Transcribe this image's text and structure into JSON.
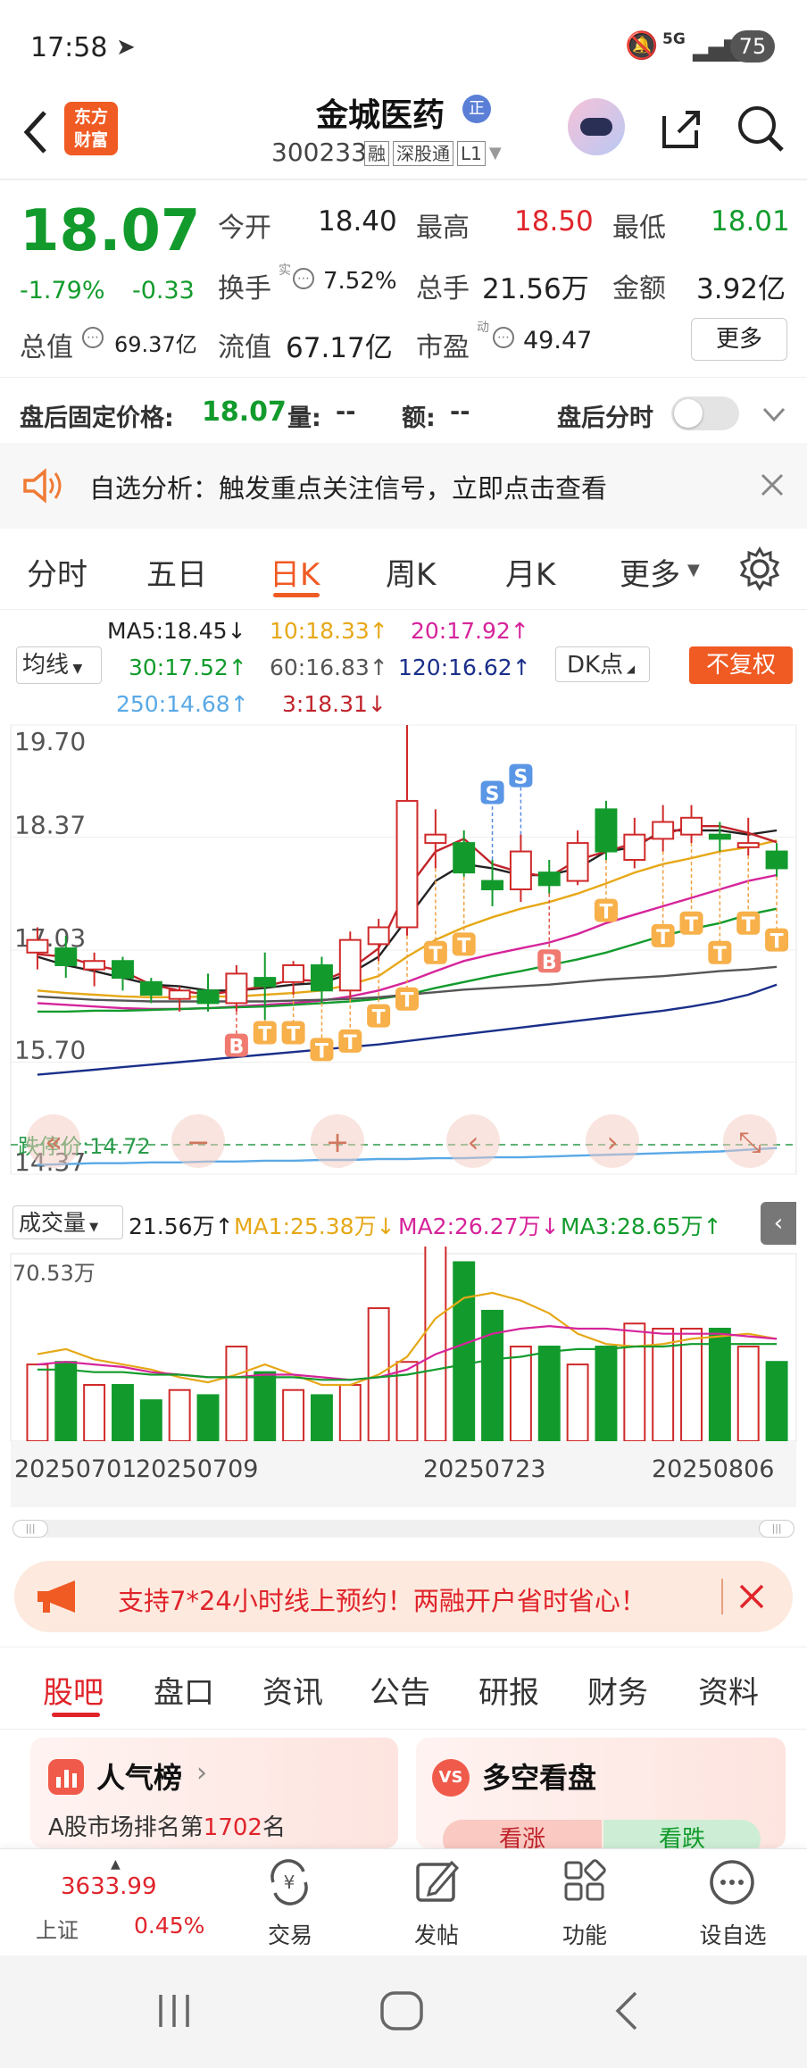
{
  "status_bar": {
    "time": "17:58",
    "battery": "75",
    "signal_label": "5G"
  },
  "header": {
    "title": "金城医药",
    "code": "300233",
    "badges": [
      "融",
      "深股通",
      "L1"
    ],
    "logo_line1": "东方",
    "logo_line2": "财富",
    "title_badge": "正"
  },
  "quote": {
    "price": "18.07",
    "change_pct": "-1.79%",
    "change": "-0.33",
    "stats": [
      {
        "label": "今开",
        "value": "18.40"
      },
      {
        "label": "最高",
        "value": "18.50"
      },
      {
        "label": "最低",
        "value": "18.01"
      },
      {
        "label": "换手",
        "value": "7.52%"
      },
      {
        "label": "总手",
        "value": "21.56万"
      },
      {
        "label": "金额",
        "value": "3.92亿"
      },
      {
        "label": "总值",
        "value": "69.37亿"
      },
      {
        "label": "流值",
        "value": "67.17亿"
      },
      {
        "label": "市盈",
        "value": "49.47"
      }
    ],
    "turnover_sup": "实",
    "pe_sup": "动",
    "more_button": "更多"
  },
  "after_hours": {
    "price_label": "盘后固定价格:",
    "price": "18.07",
    "volume_label": "量:",
    "volume": "--",
    "amount_label": "额:",
    "amount": "--",
    "timeshare_label": "盘后分时"
  },
  "notice": {
    "text": "自选分析：触发重点关注信号，立即点击查看"
  },
  "chart_tabs": [
    "分时",
    "五日",
    "日K",
    "周K",
    "月K",
    "更多"
  ],
  "ma_legend": {
    "selector": "均线",
    "items": [
      {
        "text": "MA5:18.45↓",
        "color": "#222222"
      },
      {
        "text": "10:18.33↑",
        "color": "#e6a817"
      },
      {
        "text": "20:17.92↑",
        "color": "#d6249b"
      },
      {
        "text": "30:17.52↑",
        "color": "#129b2c"
      },
      {
        "text": "60:16.83↑",
        "color": "#555555"
      },
      {
        "text": "120:16.62↑",
        "color": "#1a2f8a"
      },
      {
        "text": "250:14.68↑",
        "color": "#5aa9e6"
      },
      {
        "text": "3:18.31↓",
        "color": "#c0242b"
      }
    ],
    "dk_button": "DK点",
    "fq_button": "不复权"
  },
  "chart_data": {
    "type": "candlestick",
    "y_ticks": [
      "19.70",
      "18.37",
      "17.03",
      "15.70",
      "14.37"
    ],
    "ylim": [
      14.37,
      19.7
    ],
    "limit_down_label": "跌停价:14.72",
    "limit_down": 14.72,
    "candles": [
      {
        "o": 17.0,
        "c": 17.15,
        "h": 17.3,
        "l": 16.8
      },
      {
        "o": 17.05,
        "c": 16.85,
        "h": 17.2,
        "l": 16.7
      },
      {
        "o": 16.8,
        "c": 16.9,
        "h": 17.0,
        "l": 16.6
      },
      {
        "o": 16.9,
        "c": 16.7,
        "h": 16.95,
        "l": 16.55
      },
      {
        "o": 16.65,
        "c": 16.5,
        "h": 16.7,
        "l": 16.4
      },
      {
        "o": 16.45,
        "c": 16.55,
        "h": 16.6,
        "l": 16.3
      },
      {
        "o": 16.55,
        "c": 16.4,
        "h": 16.75,
        "l": 16.3
      },
      {
        "o": 16.4,
        "c": 16.75,
        "h": 16.85,
        "l": 16.3
      },
      {
        "o": 16.7,
        "c": 16.6,
        "h": 17.0,
        "l": 16.2
      },
      {
        "o": 16.65,
        "c": 16.85,
        "h": 16.9,
        "l": 16.5
      },
      {
        "o": 16.85,
        "c": 16.55,
        "h": 16.95,
        "l": 16.4
      },
      {
        "o": 16.55,
        "c": 17.15,
        "h": 17.25,
        "l": 16.45
      },
      {
        "o": 17.1,
        "c": 17.3,
        "h": 17.4,
        "l": 16.9
      },
      {
        "o": 17.3,
        "c": 18.8,
        "h": 19.7,
        "l": 17.2
      },
      {
        "o": 18.3,
        "c": 18.4,
        "h": 18.7,
        "l": 18.0
      },
      {
        "o": 18.3,
        "c": 17.95,
        "h": 18.45,
        "l": 17.9
      },
      {
        "o": 17.85,
        "c": 17.75,
        "h": 18.1,
        "l": 17.55
      },
      {
        "o": 17.75,
        "c": 18.2,
        "h": 18.4,
        "l": 17.6
      },
      {
        "o": 17.95,
        "c": 17.8,
        "h": 18.1,
        "l": 17.7
      },
      {
        "o": 17.85,
        "c": 18.3,
        "h": 18.45,
        "l": 17.8
      },
      {
        "o": 18.7,
        "c": 18.2,
        "h": 18.8,
        "l": 18.1
      },
      {
        "o": 18.1,
        "c": 18.4,
        "h": 18.6,
        "l": 18.0
      },
      {
        "o": 18.35,
        "c": 18.55,
        "h": 18.75,
        "l": 18.2
      },
      {
        "o": 18.4,
        "c": 18.6,
        "h": 18.75,
        "l": 18.3
      },
      {
        "o": 18.4,
        "c": 18.35,
        "h": 18.55,
        "l": 18.2
      },
      {
        "o": 18.25,
        "c": 18.3,
        "h": 18.6,
        "l": 18.15
      },
      {
        "o": 18.2,
        "c": 18.0,
        "h": 18.3,
        "l": 17.9
      }
    ],
    "markers": [
      {
        "i": 7,
        "t": "B",
        "y": 15.9
      },
      {
        "i": 8,
        "t": "T",
        "y": 16.05
      },
      {
        "i": 9,
        "t": "T",
        "y": 16.05
      },
      {
        "i": 10,
        "t": "T",
        "y": 15.85
      },
      {
        "i": 11,
        "t": "T",
        "y": 15.95
      },
      {
        "i": 12,
        "t": "T",
        "y": 16.25
      },
      {
        "i": 13,
        "t": "T",
        "y": 16.45
      },
      {
        "i": 14,
        "t": "T",
        "y": 17.0
      },
      {
        "i": 15,
        "t": "T",
        "y": 17.1
      },
      {
        "i": 18,
        "t": "B",
        "y": 16.9
      },
      {
        "i": 20,
        "t": "T",
        "y": 17.5
      },
      {
        "i": 22,
        "t": "T",
        "y": 17.2
      },
      {
        "i": 23,
        "t": "T",
        "y": 17.35
      },
      {
        "i": 24,
        "t": "T",
        "y": 17.0
      },
      {
        "i": 25,
        "t": "T",
        "y": 17.35
      },
      {
        "i": 26,
        "t": "T",
        "y": 17.15
      },
      {
        "i": 16,
        "t": "S",
        "y": 18.9
      },
      {
        "i": 17,
        "t": "S",
        "y": 19.1
      }
    ],
    "ma_lines": [
      {
        "name": "MA5",
        "color": "#222222",
        "values": [
          16.95,
          16.85,
          16.78,
          16.7,
          16.62,
          16.6,
          16.55,
          16.55,
          16.58,
          16.62,
          16.64,
          16.75,
          16.95,
          17.4,
          17.85,
          18.05,
          18.0,
          17.92,
          17.92,
          18.0,
          18.2,
          18.25,
          18.45,
          18.45,
          18.45,
          18.4,
          18.45
        ]
      },
      {
        "name": "MA10",
        "color": "#e6a817",
        "values": [
          16.55,
          16.52,
          16.5,
          16.48,
          16.47,
          16.47,
          16.48,
          16.48,
          16.5,
          16.52,
          16.55,
          16.62,
          16.72,
          16.95,
          17.15,
          17.3,
          17.42,
          17.52,
          17.6,
          17.7,
          17.82,
          17.95,
          18.05,
          18.12,
          18.2,
          18.25,
          18.33
        ]
      },
      {
        "name": "MA20",
        "color": "#d6249b",
        "values": [
          16.4,
          16.38,
          16.36,
          16.34,
          16.33,
          16.33,
          16.34,
          16.36,
          16.38,
          16.4,
          16.43,
          16.48,
          16.55,
          16.65,
          16.78,
          16.9,
          16.98,
          17.05,
          17.12,
          17.22,
          17.35,
          17.45,
          17.55,
          17.65,
          17.75,
          17.85,
          17.92
        ]
      },
      {
        "name": "MA30",
        "color": "#129b2c",
        "values": [
          16.3,
          16.3,
          16.31,
          16.31,
          16.32,
          16.33,
          16.34,
          16.35,
          16.36,
          16.38,
          16.4,
          16.42,
          16.45,
          16.5,
          16.58,
          16.65,
          16.72,
          16.78,
          16.85,
          16.92,
          17.0,
          17.1,
          17.2,
          17.28,
          17.35,
          17.45,
          17.52
        ]
      },
      {
        "name": "MA60",
        "color": "#555555",
        "values": [
          16.48,
          16.46,
          16.44,
          16.43,
          16.42,
          16.42,
          16.42,
          16.42,
          16.42,
          16.43,
          16.44,
          16.45,
          16.47,
          16.5,
          16.53,
          16.56,
          16.58,
          16.6,
          16.62,
          16.65,
          16.68,
          16.7,
          16.72,
          16.75,
          16.78,
          16.8,
          16.83
        ]
      },
      {
        "name": "MA120",
        "color": "#1a2f8a",
        "values": [
          15.55,
          15.58,
          15.61,
          15.64,
          15.67,
          15.7,
          15.73,
          15.76,
          15.79,
          15.82,
          15.85,
          15.88,
          15.91,
          15.95,
          15.99,
          16.03,
          16.07,
          16.11,
          16.15,
          16.19,
          16.23,
          16.27,
          16.31,
          16.36,
          16.42,
          16.5,
          16.62
        ]
      },
      {
        "name": "MA250",
        "color": "#5aa9e6",
        "values": [
          14.48,
          14.49,
          14.5,
          14.5,
          14.51,
          14.51,
          14.52,
          14.52,
          14.53,
          14.53,
          14.54,
          14.54,
          14.55,
          14.55,
          14.56,
          14.56,
          14.57,
          14.57,
          14.58,
          14.59,
          14.6,
          14.61,
          14.62,
          14.63,
          14.64,
          14.66,
          14.68
        ]
      },
      {
        "name": "3",
        "color": "#c0242b",
        "values": [
          16.98,
          16.95,
          16.85,
          16.78,
          16.62,
          16.55,
          16.5,
          16.55,
          16.6,
          16.68,
          16.66,
          16.8,
          17.05,
          17.75,
          18.2,
          18.35,
          18.05,
          17.95,
          17.9,
          18.1,
          18.2,
          18.3,
          18.4,
          18.5,
          18.5,
          18.42,
          18.31
        ]
      }
    ],
    "volume": {
      "selector": "成交量",
      "current": "21.56万↑",
      "ma_labels": [
        {
          "text": "MA1:25.38万↓",
          "color": "#e6a817"
        },
        {
          "text": "MA2:26.27万↓",
          "color": "#d6249b"
        },
        {
          "text": "MA3:28.65万↑",
          "color": "#129b2c"
        }
      ],
      "max_label": "70.53万",
      "max": 70.53,
      "values": [
        30,
        31,
        22,
        22,
        16,
        20,
        18,
        37,
        27,
        20,
        18,
        22,
        52,
        31,
        83,
        70,
        51,
        37,
        37,
        30,
        37,
        46,
        44,
        44,
        44,
        37,
        31
      ],
      "ma1": [
        34,
        36,
        32,
        30,
        28,
        25,
        23,
        26,
        30,
        26,
        22,
        22,
        26,
        33,
        48,
        56,
        58,
        55,
        50,
        42,
        38,
        37,
        38,
        40,
        41,
        42,
        40
      ],
      "ma2": [
        30,
        31,
        30,
        29,
        27,
        26,
        25,
        25,
        26,
        26,
        25,
        24,
        25,
        28,
        34,
        38,
        42,
        44,
        45,
        44,
        44,
        43,
        42,
        42,
        42,
        41,
        40
      ],
      "ma3": [
        28,
        28,
        27,
        27,
        26,
        26,
        25,
        25,
        25,
        25,
        24,
        24,
        25,
        26,
        28,
        30,
        32,
        33,
        35,
        36,
        36,
        37,
        37,
        38,
        38,
        38,
        38
      ],
      "dates": [
        "20250701",
        "20250709",
        "20250723",
        "20250806"
      ]
    }
  },
  "banner": {
    "text": "支持7*24小时线上预约！两融开户省时省心！"
  },
  "sub_tabs": [
    "股吧",
    "盘口",
    "资讯",
    "公告",
    "研报",
    "财务",
    "资料"
  ],
  "cards": {
    "popularity_title": "人气榜",
    "popularity_rank_prefix": "A股市场排名第",
    "popularity_rank": "1702",
    "popularity_rank_suffix": "名",
    "vs_title": "多空看盘",
    "bull": "看涨",
    "bear": "看跌"
  },
  "bottom_bar": {
    "index_value": "3633.99",
    "index_name": "上证",
    "index_change": "0.45%",
    "items": [
      "交易",
      "发帖",
      "功能",
      "设自选"
    ]
  }
}
